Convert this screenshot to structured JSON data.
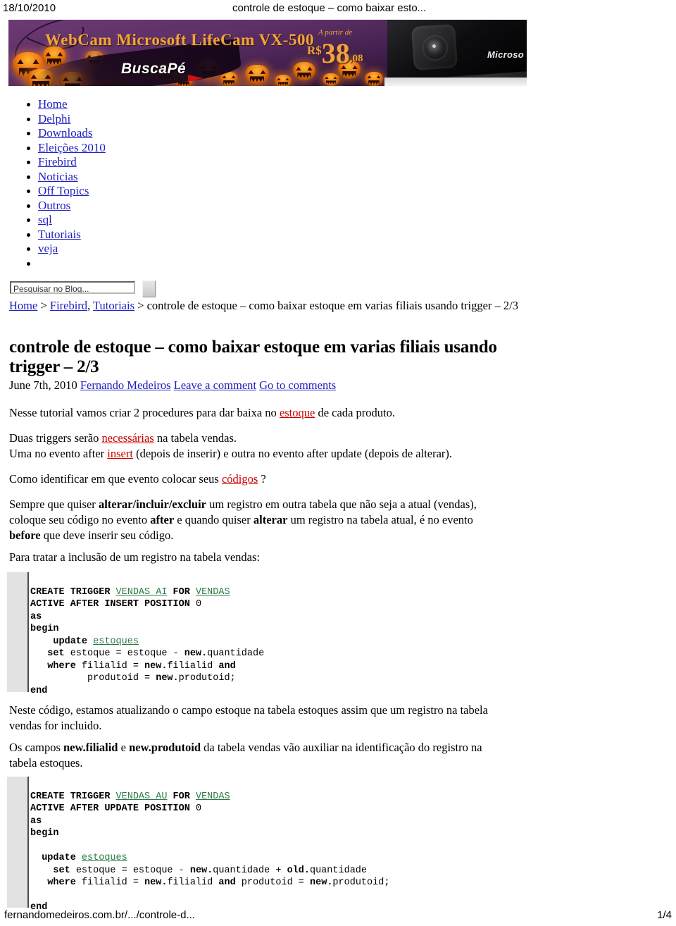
{
  "print_header": {
    "date": "18/10/2010",
    "title": "controle de estoque – como baixar esto..."
  },
  "banner": {
    "product_title": "WebCam Microsoft LifeCam VX-500",
    "price_prefix": "A partir de",
    "currency": "R$",
    "price_int": "38",
    "price_cents": ",08",
    "brand_logo": "BuscaPé",
    "product_brand": "Microso"
  },
  "sidebar": {
    "items": [
      {
        "label": "Home"
      },
      {
        "label": "Delphi"
      },
      {
        "label": "Downloads"
      },
      {
        "label": "Eleições 2010"
      },
      {
        "label": "Firebird"
      },
      {
        "label": "Noticias"
      },
      {
        "label": "Off Topics"
      },
      {
        "label": "Outros"
      },
      {
        "label": "sql"
      },
      {
        "label": "Tutoriais"
      },
      {
        "label": "veja"
      },
      {
        "label": ""
      }
    ]
  },
  "search": {
    "value": "Pesquisar no Blog...",
    "placeholder": "Pesquisar no Blog..."
  },
  "breadcrumb": {
    "home": "Home",
    "sep1": " > ",
    "firebird": "Firebird",
    "comma": ", ",
    "tutoriais": "Tutoriais",
    "sep2": " > ",
    "current": "controle de estoque – como baixar estoque em varias filiais usando trigger – 2/3"
  },
  "post": {
    "title": "controle de estoque – como baixar estoque em varias filiais usando trigger – 2/3",
    "date": "June 7th, 2010",
    "author": "Fernando Medeiros",
    "leave_comment": "Leave a comment",
    "go_to_comments": "Go to comments",
    "p1_a": "Nesse tutorial vamos criar 2 procedures para dar baixa no ",
    "p1_link": "estoque",
    "p1_b": " de cada produto.",
    "p2_a": "Duas triggers serão ",
    "p2_link": "necessárias",
    "p2_b": " na tabela vendas.",
    "p3_a": "Uma no evento after ",
    "p3_link": "insert",
    "p3_b": " (depois de inserir) e outra no evento after update (depois de alterar).",
    "p4_a": "Como identificar em que evento colocar seus ",
    "p4_link": "códigos",
    "p4_b": " ?",
    "p5_a": "Sempre que quiser ",
    "p5_b1": "alterar/incluir/excluir",
    "p5_b": " um registro em outra tabela que não seja a atual (vendas), coloque seu código no evento ",
    "p5_b2": "after",
    "p5_c": " e quando quiser ",
    "p5_b3": "alterar",
    "p5_d": " um registro na tabela atual, é no evento ",
    "p5_b4": "before",
    "p5_e": " que deve inserir seu código.",
    "p6": "Para tratar a inclusão de um registro na tabela vendas:",
    "p7": "Neste código, estamos atualizando o campo estoque na tabela estoques assim que um registro na tabela vendas for incluido.",
    "p8_a": "Os campos ",
    "p8_b1": "new.filialid",
    "p8_b": " e ",
    "p8_b2": "new.produtoid",
    "p8_c": " da tabela vendas vão auxiliar na identificação do registro na tabela estoques."
  },
  "code_block_1": {
    "lines": [
      [
        {
          "t": "CREATE TRIGGER ",
          "k": "kw"
        },
        {
          "t": "VENDAS_AI",
          "k": "id"
        },
        {
          "t": " FOR ",
          "k": "kw"
        },
        {
          "t": "VENDAS",
          "k": "id"
        }
      ],
      [
        {
          "t": "ACTIVE AFTER INSERT POSITION ",
          "k": "kw"
        },
        {
          "t": "0",
          "k": "nb"
        }
      ],
      [
        {
          "t": "as",
          "k": "kw"
        }
      ],
      [
        {
          "t": "begin",
          "k": "kw"
        }
      ],
      [
        {
          "t": "    update ",
          "k": "kw"
        },
        {
          "t": "estoques",
          "k": "id"
        }
      ],
      [
        {
          "t": "   set ",
          "k": "kw"
        },
        {
          "t": "estoque = estoque - ",
          "k": "nb"
        },
        {
          "t": "new.",
          "k": "kw"
        },
        {
          "t": "quantidade",
          "k": "nb"
        }
      ],
      [
        {
          "t": "   where ",
          "k": "kw"
        },
        {
          "t": "filialid = ",
          "k": "nb"
        },
        {
          "t": "new.",
          "k": "kw"
        },
        {
          "t": "filialid ",
          "k": "nb"
        },
        {
          "t": "and",
          "k": "kw"
        }
      ],
      [
        {
          "t": "          produtoid = ",
          "k": "nb"
        },
        {
          "t": "new.",
          "k": "kw"
        },
        {
          "t": "produtoid;",
          "k": "nb"
        }
      ],
      [
        {
          "t": "end",
          "k": "kw"
        }
      ]
    ]
  },
  "code_block_2": {
    "lines": [
      [
        {
          "t": "CREATE TRIGGER ",
          "k": "kw"
        },
        {
          "t": "VENDAS_AU",
          "k": "id"
        },
        {
          "t": " FOR ",
          "k": "kw"
        },
        {
          "t": "VENDAS",
          "k": "id"
        }
      ],
      [
        {
          "t": "ACTIVE AFTER UPDATE POSITION ",
          "k": "kw"
        },
        {
          "t": "0",
          "k": "nb"
        }
      ],
      [
        {
          "t": "as",
          "k": "kw"
        }
      ],
      [
        {
          "t": "begin",
          "k": "kw"
        }
      ],
      [
        {
          "t": "",
          "k": "nb"
        }
      ],
      [
        {
          "t": "  update ",
          "k": "kw"
        },
        {
          "t": "estoques",
          "k": "id"
        }
      ],
      [
        {
          "t": "    set ",
          "k": "kw"
        },
        {
          "t": "estoque = estoque - ",
          "k": "nb"
        },
        {
          "t": "new.",
          "k": "kw"
        },
        {
          "t": "quantidade + ",
          "k": "nb"
        },
        {
          "t": "old.",
          "k": "kw"
        },
        {
          "t": "quantidade",
          "k": "nb"
        }
      ],
      [
        {
          "t": "   where ",
          "k": "kw"
        },
        {
          "t": "filialid = ",
          "k": "nb"
        },
        {
          "t": "new.",
          "k": "kw"
        },
        {
          "t": "filialid ",
          "k": "nb"
        },
        {
          "t": "and",
          "k": "kw"
        },
        {
          "t": " produtoid = ",
          "k": "nb"
        },
        {
          "t": "new.",
          "k": "kw"
        },
        {
          "t": "produtoid;",
          "k": "nb"
        }
      ],
      [
        {
          "t": "",
          "k": "nb"
        }
      ],
      [
        {
          "t": "end",
          "k": "kw"
        }
      ]
    ]
  },
  "footer": {
    "url": "fernandomedeiros.com.br/.../controle-d...",
    "page": "1/4"
  },
  "colors": {
    "link": "#2020c0",
    "spellcheck_link": "#cc0000",
    "code_identifier": "#2e7a46",
    "banner_purple": "#5c2f66",
    "banner_orange": "#f2a43a"
  }
}
